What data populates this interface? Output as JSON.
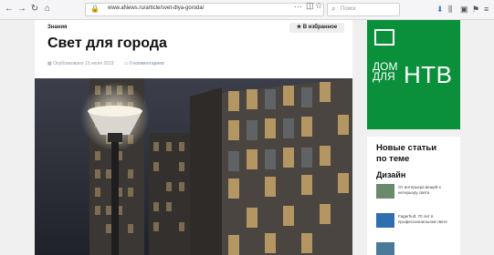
{
  "browser": {
    "url": "www.aNews.ru/article/svet-dlya-goroda/",
    "search_placeholder": "Поиск"
  },
  "article": {
    "category": "Знания",
    "favorite_label": "★ В избранное",
    "title": "Свет для города",
    "published": "Опубликовано 15 июля 2019",
    "comments": "0 комментариев"
  },
  "sidebar": {
    "ad": {
      "line1": "ДОМ",
      "line2": "ДЛЯ",
      "brand": "НТВ"
    },
    "new_articles_heading": "Новые статьи по теме",
    "tag": "Дизайн",
    "items": [
      {
        "text": "От интерьера вещей к интерьеру света"
      },
      {
        "text": "Fagerhult: 70 лет в профессиональном свете"
      },
      {
        "text": ""
      }
    ]
  },
  "colors": {
    "ntv_green": "#0a8f3a"
  }
}
